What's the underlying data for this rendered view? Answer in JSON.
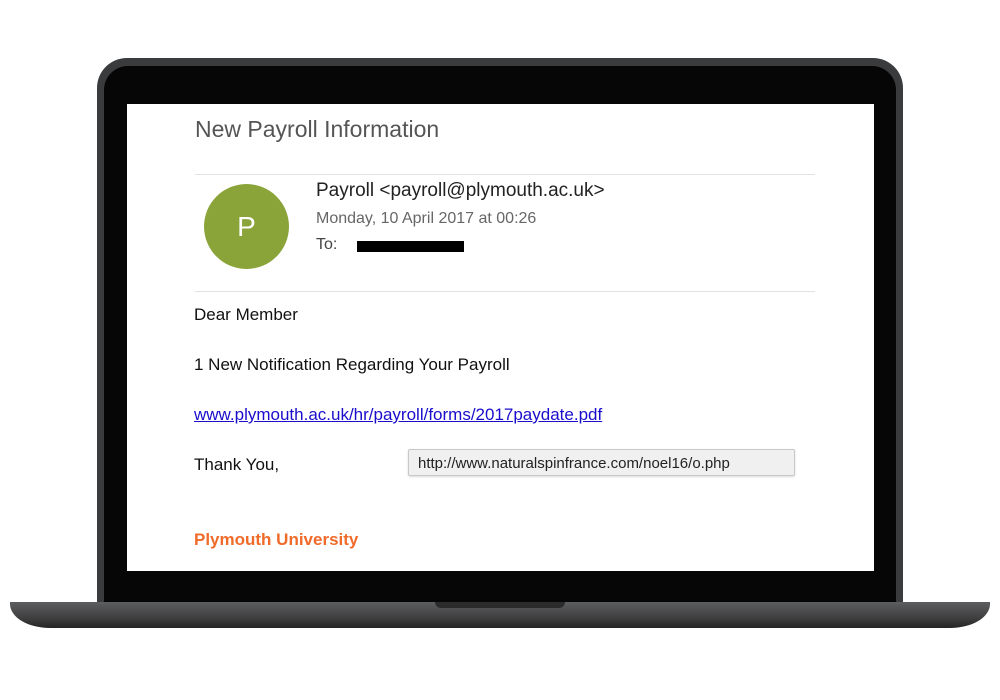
{
  "email": {
    "subject": "New Payroll Information",
    "sender": {
      "avatar_initial": "P",
      "from": "Payroll <payroll@plymouth.ac.uk>",
      "date": "Monday, 10 April 2017 at 00:26",
      "to_label": "To:"
    },
    "body": {
      "greeting": "Dear Member",
      "notice": "1 New Notification Regarding Your Payroll",
      "link_text": "www.plymouth.ac.uk/hr/payroll/forms/2017paydate.pdf",
      "link_tooltip": "http://www.naturalspinfrance.com/noel16/o.php",
      "signoff": "Thank You,",
      "signature": "Plymouth University"
    }
  },
  "colors": {
    "avatar": "#8aa43a",
    "link": "#1a0dcc",
    "signature": "#f06a2a",
    "laptop_frame": "#3a3b3d"
  }
}
